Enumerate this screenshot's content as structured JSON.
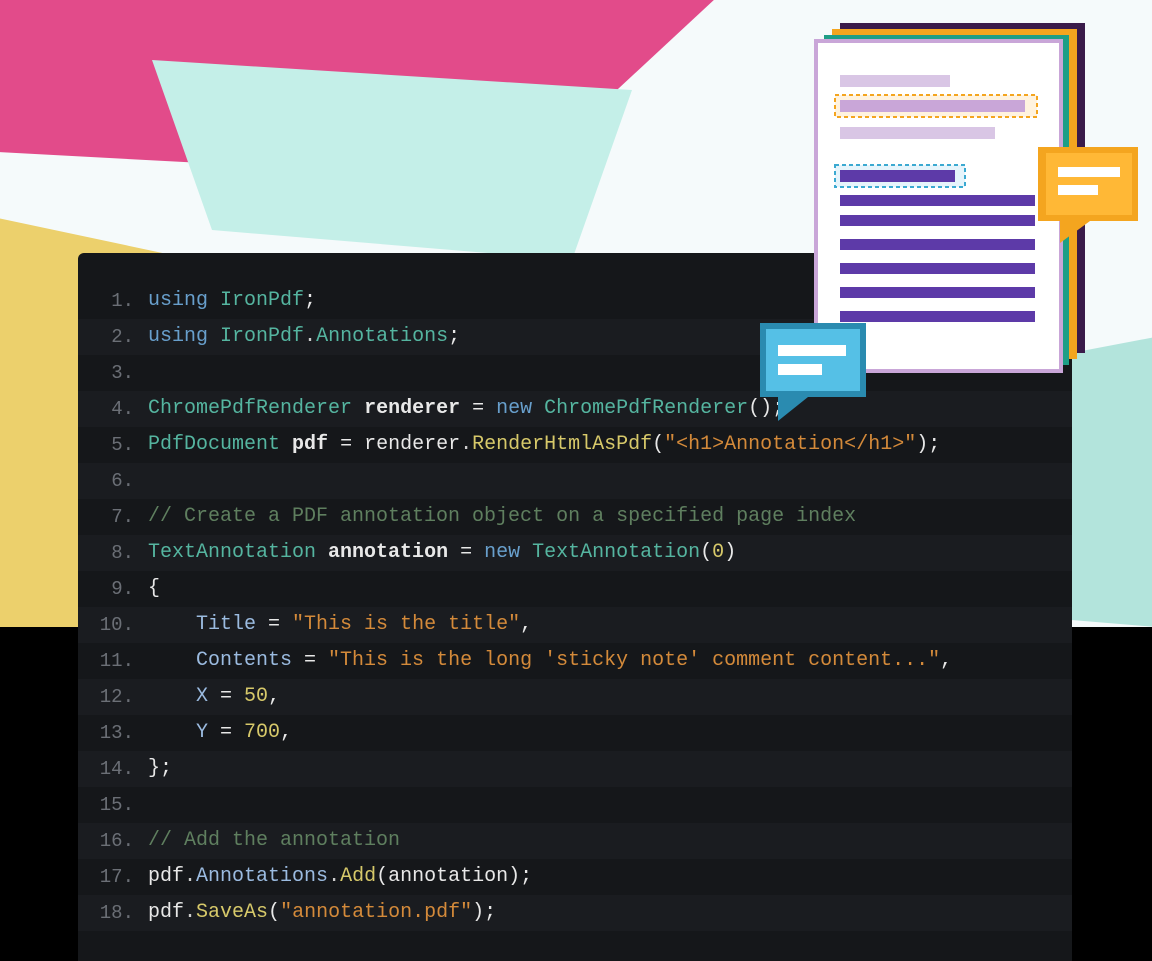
{
  "code": {
    "lines": [
      {
        "n": "1",
        "tokens": [
          [
            "kw",
            "using"
          ],
          [
            "op",
            " "
          ],
          [
            "type",
            "IronPdf"
          ],
          [
            "op",
            ";"
          ]
        ]
      },
      {
        "n": "2",
        "tokens": [
          [
            "kw",
            "using"
          ],
          [
            "op",
            " "
          ],
          [
            "type",
            "IronPdf"
          ],
          [
            "dot",
            "."
          ],
          [
            "type",
            "Annotations"
          ],
          [
            "op",
            ";"
          ]
        ]
      },
      {
        "n": "3",
        "tokens": []
      },
      {
        "n": "4",
        "tokens": [
          [
            "type",
            "ChromePdfRenderer"
          ],
          [
            "op",
            " "
          ],
          [
            "var",
            "renderer"
          ],
          [
            "op",
            " = "
          ],
          [
            "kw",
            "new"
          ],
          [
            "op",
            " "
          ],
          [
            "type",
            "ChromePdfRenderer"
          ],
          [
            "op",
            "();"
          ]
        ]
      },
      {
        "n": "5",
        "tokens": [
          [
            "type",
            "PdfDocument"
          ],
          [
            "op",
            " "
          ],
          [
            "var",
            "pdf"
          ],
          [
            "op",
            " = renderer"
          ],
          [
            "dot",
            "."
          ],
          [
            "meth",
            "RenderHtmlAsPdf"
          ],
          [
            "op",
            "("
          ],
          [
            "str",
            "\"<h1>Annotation</h1>\""
          ],
          [
            "op",
            ");"
          ]
        ]
      },
      {
        "n": "6",
        "tokens": []
      },
      {
        "n": "7",
        "tokens": [
          [
            "cm",
            "// Create a PDF annotation object on a specified page index"
          ]
        ]
      },
      {
        "n": "8",
        "tokens": [
          [
            "type",
            "TextAnnotation"
          ],
          [
            "op",
            " "
          ],
          [
            "var",
            "annotation"
          ],
          [
            "op",
            " = "
          ],
          [
            "kw",
            "new"
          ],
          [
            "op",
            " "
          ],
          [
            "type",
            "TextAnnotation"
          ],
          [
            "op",
            "("
          ],
          [
            "num",
            "0"
          ],
          [
            "op",
            ")"
          ]
        ]
      },
      {
        "n": "9",
        "tokens": [
          [
            "op",
            "{"
          ]
        ]
      },
      {
        "n": "10",
        "tokens": [
          [
            "op",
            "    "
          ],
          [
            "prop",
            "Title"
          ],
          [
            "op",
            " = "
          ],
          [
            "str",
            "\"This is the title\""
          ],
          [
            "op",
            ","
          ]
        ]
      },
      {
        "n": "11",
        "tokens": [
          [
            "op",
            "    "
          ],
          [
            "prop",
            "Contents"
          ],
          [
            "op",
            " = "
          ],
          [
            "str",
            "\"This is the long 'sticky note' comment content...\""
          ],
          [
            "op",
            ","
          ]
        ]
      },
      {
        "n": "12",
        "tokens": [
          [
            "op",
            "    "
          ],
          [
            "prop",
            "X"
          ],
          [
            "op",
            " = "
          ],
          [
            "num",
            "50"
          ],
          [
            "op",
            ","
          ]
        ]
      },
      {
        "n": "13",
        "tokens": [
          [
            "op",
            "    "
          ],
          [
            "prop",
            "Y"
          ],
          [
            "op",
            " = "
          ],
          [
            "num",
            "700"
          ],
          [
            "op",
            ","
          ]
        ]
      },
      {
        "n": "14",
        "tokens": [
          [
            "op",
            "};"
          ]
        ]
      },
      {
        "n": "15",
        "tokens": []
      },
      {
        "n": "16",
        "tokens": [
          [
            "cm",
            "// Add the annotation"
          ]
        ]
      },
      {
        "n": "17",
        "tokens": [
          [
            "op",
            "pdf"
          ],
          [
            "dot",
            "."
          ],
          [
            "prop",
            "Annotations"
          ],
          [
            "dot",
            "."
          ],
          [
            "meth",
            "Add"
          ],
          [
            "op",
            "(annotation);"
          ]
        ]
      },
      {
        "n": "18",
        "tokens": [
          [
            "op",
            "pdf"
          ],
          [
            "dot",
            "."
          ],
          [
            "meth",
            "SaveAs"
          ],
          [
            "op",
            "("
          ],
          [
            "str",
            "\"annotation.pdf\""
          ],
          [
            "op",
            ");"
          ]
        ]
      }
    ]
  }
}
